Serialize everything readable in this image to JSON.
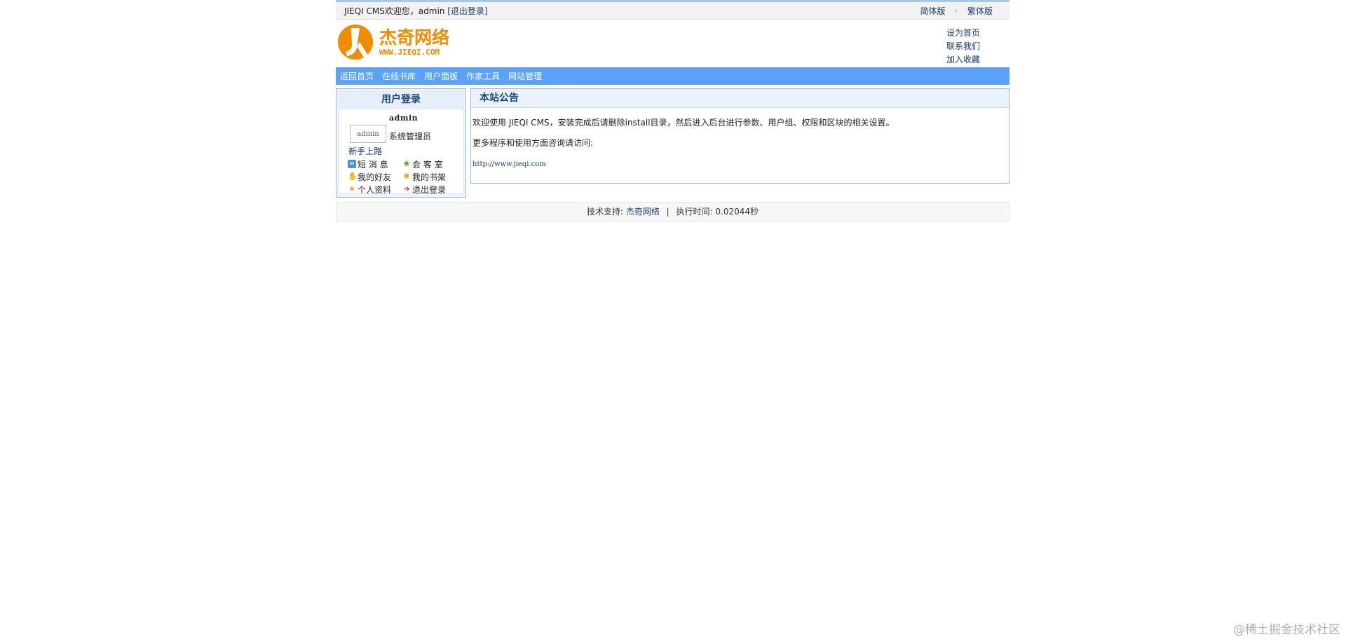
{
  "topbar": {
    "welcome": "JIEQI CMS欢迎您，admin",
    "logout": "[退出登录]",
    "simplified": "简体版",
    "separator": "·",
    "traditional": "繁体版"
  },
  "header": {
    "logo_text": "杰奇网络",
    "logo_url_text": "WWW.JIEQI.COM",
    "links": [
      "设为首页",
      "联系我们",
      "加入收藏"
    ]
  },
  "nav": {
    "items": [
      "返回首页",
      "在线书库",
      "用户面板",
      "作家工具",
      "网站管理"
    ]
  },
  "login": {
    "title": "用户登录",
    "avatar_alt": "admin",
    "username": "admin",
    "role": "系统管理员",
    "newbie": "新手上路",
    "links": [
      {
        "label": "短 消 息",
        "icon": "mail-icon"
      },
      {
        "label": "会 客 室",
        "icon": "chat-icon"
      },
      {
        "label": "我的好友",
        "icon": "friends-icon"
      },
      {
        "label": "我的书架",
        "icon": "bookshelf-icon"
      },
      {
        "label": "个人资料",
        "icon": "profile-icon"
      },
      {
        "label": "退出登录",
        "icon": "logout-icon"
      }
    ]
  },
  "notice": {
    "title": "本站公告",
    "line1": "欢迎使用 JIEQI CMS，安装完成后请删除install目录，然后进入后台进行参数、用户组、权限和区块的相关设置。",
    "line2": "更多程序和使用方面咨询请访问:",
    "url": "http://www.jieqi.com"
  },
  "footer": {
    "support_label": "技术支持:",
    "support_link": "杰奇网络",
    "separator": "|",
    "exec_time": "执行时间: 0.02044秒"
  },
  "watermark": "@稀土掘金技术社区",
  "colors": {
    "nav_bg": "#5aa2f7",
    "logo_orange": "#f08c00",
    "link": "#1a3a6e"
  }
}
